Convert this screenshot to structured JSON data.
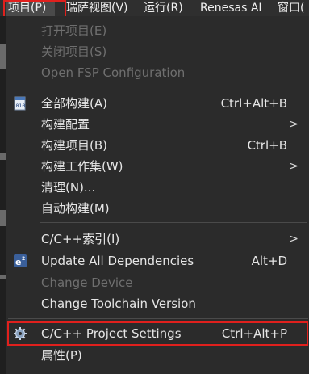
{
  "menubar": {
    "items": [
      {
        "label": "项目(P)"
      },
      {
        "label": "瑞萨视图(V)"
      },
      {
        "label": "运行(R)"
      },
      {
        "label": "Renesas AI"
      },
      {
        "label": "窗口("
      }
    ]
  },
  "menu": {
    "open_project": "打开项目(E)",
    "close_project": "关闭项目(S)",
    "open_fsp": "Open FSP Configuration",
    "build_all": "全部构建(A)",
    "build_all_shortcut": "Ctrl+Alt+B",
    "build_config": "构建配置",
    "build_project": "构建项目(B)",
    "build_project_shortcut": "Ctrl+B",
    "build_working_set": "构建工作集(W)",
    "clean": "清理(N)...",
    "auto_build": "自动构建(M)",
    "cpp_index": "C/C++索引(I)",
    "update_deps": "Update All Dependencies",
    "update_deps_shortcut": "Alt+D",
    "change_device": "Change Device",
    "change_toolchain": "Change Toolchain Version",
    "cpp_settings": "C/C++ Project Settings",
    "cpp_settings_shortcut": "Ctrl+Alt+P",
    "properties": "属性(P)",
    "submenu_arrow": ">"
  },
  "colors": {
    "highlight_border": "#e0201d",
    "menu_bg": "#2b2b2b",
    "disabled_text": "#6f6f6f"
  }
}
